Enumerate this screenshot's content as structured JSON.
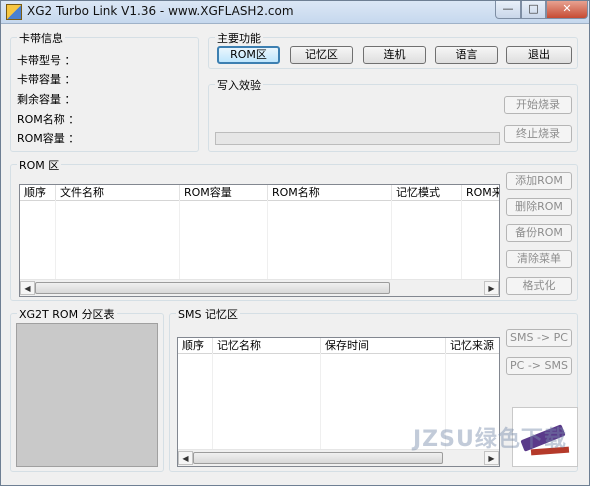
{
  "window": {
    "title": "XG2 Turbo Link V1.36 - www.XGFLASH2.com",
    "controls": {
      "minimize": "—",
      "maximize": "□",
      "close": "✕"
    }
  },
  "card_info": {
    "title": "卡带信息",
    "fields": [
      "卡带型号 ：",
      "卡带容量 ：",
      "剩余容量 ：",
      "ROM名称 ：",
      "ROM容量 ："
    ]
  },
  "main_functions": {
    "title": "主要功能",
    "buttons": [
      "ROM区",
      "记忆区",
      "连机",
      "语言",
      "退出"
    ],
    "active": "ROM区"
  },
  "burn": {
    "title": "写入效验",
    "start_label": "开始烧录",
    "stop_label": "终止烧录",
    "progress": 0
  },
  "rom_area": {
    "title": "ROM 区",
    "columns": [
      "顺序",
      "文件名称",
      "ROM容量",
      "ROM名称",
      "记忆模式",
      "ROM来源"
    ],
    "rows": [],
    "buttons": [
      "添加ROM",
      "删除ROM",
      "备份ROM",
      "清除菜单",
      "格式化"
    ]
  },
  "partition": {
    "title": "XG2T ROM 分区表"
  },
  "sms_area": {
    "title": "SMS 记忆区",
    "columns": [
      "顺序",
      "记忆名称",
      "保存时间",
      "记忆来源"
    ],
    "rows": [],
    "buttons": [
      "SMS -> PC",
      "PC -> SMS"
    ]
  },
  "watermark": "JZSU绿色下载"
}
